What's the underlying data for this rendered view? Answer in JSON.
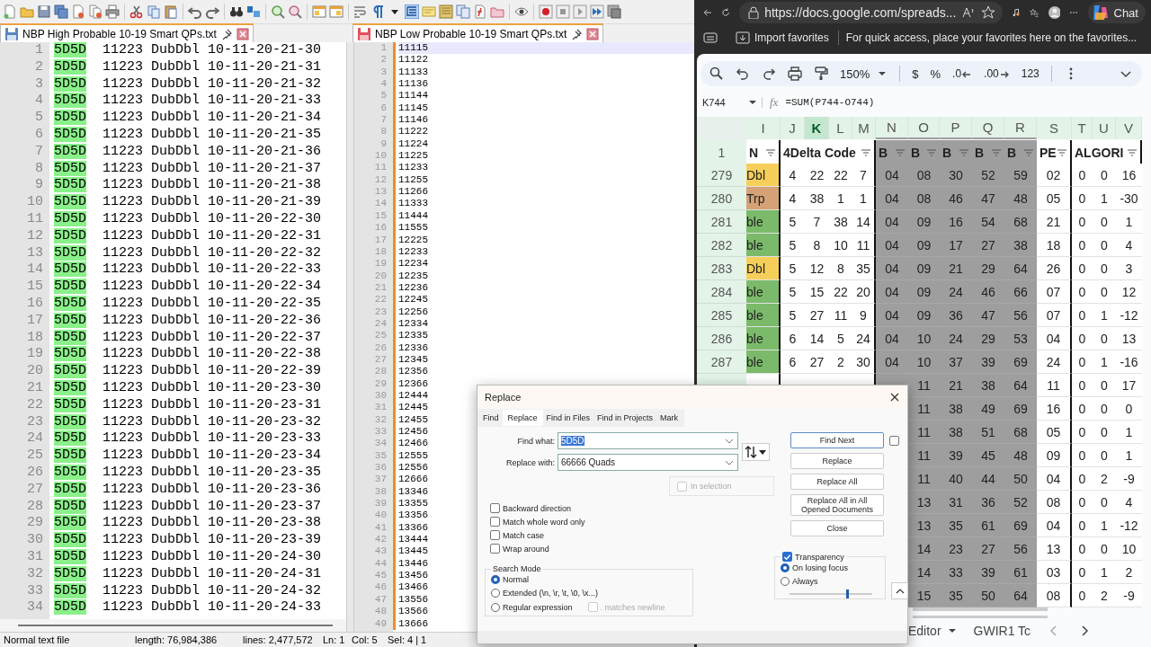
{
  "editor": {
    "tabs": [
      {
        "label": "NBP High Probable 10-19 Smart QPs.txt",
        "unsaved": false
      },
      {
        "label": "NBP Low Probable 10-19 Smart QPs.txt",
        "unsaved": true
      }
    ],
    "left_view": {
      "lines": [
        {
          "number": "1",
          "match": "5D5D",
          "text": "11223 DubDbl 10-11-20-21-30"
        },
        {
          "number": "2",
          "match": "5D5D",
          "text": "11223 DubDbl 10-11-20-21-31"
        },
        {
          "number": "3",
          "match": "5D5D",
          "text": "11223 DubDbl 10-11-20-21-32"
        },
        {
          "number": "4",
          "match": "5D5D",
          "text": "11223 DubDbl 10-11-20-21-33"
        },
        {
          "number": "5",
          "match": "5D5D",
          "text": "11223 DubDbl 10-11-20-21-34"
        },
        {
          "number": "6",
          "match": "5D5D",
          "text": "11223 DubDbl 10-11-20-21-35"
        },
        {
          "number": "7",
          "match": "5D5D",
          "text": "11223 DubDbl 10-11-20-21-36"
        },
        {
          "number": "8",
          "match": "5D5D",
          "text": "11223 DubDbl 10-11-20-21-37"
        },
        {
          "number": "9",
          "match": "5D5D",
          "text": "11223 DubDbl 10-11-20-21-38"
        },
        {
          "number": "10",
          "match": "5D5D",
          "text": "11223 DubDbl 10-11-20-21-39"
        },
        {
          "number": "11",
          "match": "5D5D",
          "text": "11223 DubDbl 10-11-20-22-30"
        },
        {
          "number": "12",
          "match": "5D5D",
          "text": "11223 DubDbl 10-11-20-22-31"
        },
        {
          "number": "13",
          "match": "5D5D",
          "text": "11223 DubDbl 10-11-20-22-32"
        },
        {
          "number": "14",
          "match": "5D5D",
          "text": "11223 DubDbl 10-11-20-22-33"
        },
        {
          "number": "15",
          "match": "5D5D",
          "text": "11223 DubDbl 10-11-20-22-34"
        },
        {
          "number": "16",
          "match": "5D5D",
          "text": "11223 DubDbl 10-11-20-22-35"
        },
        {
          "number": "17",
          "match": "5D5D",
          "text": "11223 DubDbl 10-11-20-22-36"
        },
        {
          "number": "18",
          "match": "5D5D",
          "text": "11223 DubDbl 10-11-20-22-37"
        },
        {
          "number": "19",
          "match": "5D5D",
          "text": "11223 DubDbl 10-11-20-22-38"
        },
        {
          "number": "20",
          "match": "5D5D",
          "text": "11223 DubDbl 10-11-20-22-39"
        },
        {
          "number": "21",
          "match": "5D5D",
          "text": "11223 DubDbl 10-11-20-23-30"
        },
        {
          "number": "22",
          "match": "5D5D",
          "text": "11223 DubDbl 10-11-20-23-31"
        },
        {
          "number": "23",
          "match": "5D5D",
          "text": "11223 DubDbl 10-11-20-23-32"
        },
        {
          "number": "24",
          "match": "5D5D",
          "text": "11223 DubDbl 10-11-20-23-33"
        },
        {
          "number": "25",
          "match": "5D5D",
          "text": "11223 DubDbl 10-11-20-23-34"
        },
        {
          "number": "26",
          "match": "5D5D",
          "text": "11223 DubDbl 10-11-20-23-35"
        },
        {
          "number": "27",
          "match": "5D5D",
          "text": "11223 DubDbl 10-11-20-23-36"
        },
        {
          "number": "28",
          "match": "5D5D",
          "text": "11223 DubDbl 10-11-20-23-37"
        },
        {
          "number": "29",
          "match": "5D5D",
          "text": "11223 DubDbl 10-11-20-23-38"
        },
        {
          "number": "30",
          "match": "5D5D",
          "text": "11223 DubDbl 10-11-20-23-39"
        },
        {
          "number": "31",
          "match": "5D5D",
          "text": "11223 DubDbl 10-11-20-24-30"
        },
        {
          "number": "32",
          "match": "5D5D",
          "text": "11223 DubDbl 10-11-20-24-31"
        },
        {
          "number": "33",
          "match": "5D5D",
          "text": "11223 DubDbl 10-11-20-24-32"
        },
        {
          "number": "34",
          "match": "5D5D",
          "text": "11223 DubDbl 10-11-20-24-33"
        }
      ]
    },
    "right_view": {
      "lines": [
        {
          "number": "1",
          "text": "11115",
          "current": true
        },
        {
          "number": "2",
          "text": "11122",
          "current": false
        },
        {
          "number": "3",
          "text": "11133",
          "current": false
        },
        {
          "number": "4",
          "text": "11136",
          "current": false
        },
        {
          "number": "5",
          "text": "11144",
          "current": false
        },
        {
          "number": "6",
          "text": "11145",
          "current": false
        },
        {
          "number": "7",
          "text": "11146",
          "current": false
        },
        {
          "number": "8",
          "text": "11222",
          "current": false
        },
        {
          "number": "9",
          "text": "11224",
          "current": false
        },
        {
          "number": "10",
          "text": "11225",
          "current": false
        },
        {
          "number": "11",
          "text": "11233",
          "current": false
        },
        {
          "number": "12",
          "text": "11255",
          "current": false
        },
        {
          "number": "13",
          "text": "11266",
          "current": false
        },
        {
          "number": "14",
          "text": "11333",
          "current": false
        },
        {
          "number": "15",
          "text": "11444",
          "current": false
        },
        {
          "number": "16",
          "text": "11555",
          "current": false
        },
        {
          "number": "17",
          "text": "12225",
          "current": false
        },
        {
          "number": "18",
          "text": "12233",
          "current": false
        },
        {
          "number": "19",
          "text": "12234",
          "current": false
        },
        {
          "number": "20",
          "text": "12235",
          "current": false
        },
        {
          "number": "21",
          "text": "12236",
          "current": false
        },
        {
          "number": "22",
          "text": "12245",
          "current": false
        },
        {
          "number": "23",
          "text": "12256",
          "current": false
        },
        {
          "number": "24",
          "text": "12334",
          "current": false
        },
        {
          "number": "25",
          "text": "12335",
          "current": false
        },
        {
          "number": "26",
          "text": "12336",
          "current": false
        },
        {
          "number": "27",
          "text": "12345",
          "current": false
        },
        {
          "number": "28",
          "text": "12356",
          "current": false
        },
        {
          "number": "29",
          "text": "12366",
          "current": false
        },
        {
          "number": "30",
          "text": "12444",
          "current": false
        },
        {
          "number": "31",
          "text": "12445",
          "current": false
        },
        {
          "number": "32",
          "text": "12455",
          "current": false
        },
        {
          "number": "33",
          "text": "12456",
          "current": false
        },
        {
          "number": "34",
          "text": "12466",
          "current": false
        },
        {
          "number": "35",
          "text": "12555",
          "current": false
        },
        {
          "number": "36",
          "text": "12556",
          "current": false
        },
        {
          "number": "37",
          "text": "12666",
          "current": false
        },
        {
          "number": "38",
          "text": "13346",
          "current": false
        },
        {
          "number": "39",
          "text": "13355",
          "current": false
        },
        {
          "number": "40",
          "text": "13356",
          "current": false
        },
        {
          "number": "41",
          "text": "13366",
          "current": false
        },
        {
          "number": "42",
          "text": "13444",
          "current": false
        },
        {
          "number": "43",
          "text": "13445",
          "current": false
        },
        {
          "number": "44",
          "text": "13446",
          "current": false
        },
        {
          "number": "45",
          "text": "13456",
          "current": false
        },
        {
          "number": "46",
          "text": "13466",
          "current": false
        },
        {
          "number": "47",
          "text": "13556",
          "current": false
        },
        {
          "number": "48",
          "text": "13566",
          "current": false
        },
        {
          "number": "49",
          "text": "13666",
          "current": false
        }
      ]
    },
    "status_bar": {
      "file_type": "Normal text file",
      "length": "length: 76,984,386",
      "lines": "lines: 2,477,572",
      "ln": "Ln: 1",
      "col": "Col: 5",
      "sel": "Sel: 4 | 1"
    }
  },
  "browser": {
    "url": "https://docs.google.com/spreads...",
    "chat": "Chat",
    "favorites_bar": {
      "import": "Import favorites",
      "hint": "For quick access, place your favorites here on the favorites..."
    },
    "sheets": {
      "toolbar": {
        "zoom": "150%",
        "currency": "$",
        "percent": "%",
        "decrease_decimal": ".0",
        "increase_decimal": ".00",
        "number_format": "123"
      },
      "name_box": "K744",
      "fx": "fx",
      "formula": "=SUM(P744-O744)",
      "columns": [
        {
          "label": "I",
          "selected": false,
          "shaded": false
        },
        {
          "label": "J",
          "selected": false,
          "shaded": false
        },
        {
          "label": "K",
          "selected": true,
          "shaded": false
        },
        {
          "label": "L",
          "selected": false,
          "shaded": false
        },
        {
          "label": "M",
          "selected": false,
          "shaded": false
        },
        {
          "label": "N",
          "selected": false,
          "shaded": true
        },
        {
          "label": "O",
          "selected": false,
          "shaded": true
        },
        {
          "label": "P",
          "selected": false,
          "shaded": true
        },
        {
          "label": "Q",
          "selected": false,
          "shaded": true
        },
        {
          "label": "R",
          "selected": false,
          "shaded": true
        },
        {
          "label": "S",
          "selected": false,
          "shaded": false
        },
        {
          "label": "T",
          "selected": false,
          "shaded": false
        },
        {
          "label": "U",
          "selected": false,
          "shaded": false
        },
        {
          "label": "V",
          "selected": false,
          "shaded": false
        }
      ],
      "header_row": {
        "number": "1",
        "cells": [
          "N",
          "4Delta Code",
          "B",
          "B",
          "B",
          "B",
          "B",
          "PE",
          "ALGORI"
        ]
      },
      "rows": [
        {
          "number": "279",
          "color": "#f6cf5a",
          "cells": [
            "Dbl",
            "4",
            "22",
            "22",
            "7",
            "04",
            "08",
            "30",
            "52",
            "59",
            "02",
            "0",
            "0",
            "16"
          ]
        },
        {
          "number": "280",
          "color": "#d4a276",
          "cells": [
            "Trp",
            "4",
            "38",
            "1",
            "1",
            "04",
            "08",
            "46",
            "47",
            "48",
            "05",
            "0",
            "1",
            "-30"
          ]
        },
        {
          "number": "281",
          "color": "#7bba6a",
          "cells": [
            "ble",
            "5",
            "7",
            "38",
            "14",
            "04",
            "09",
            "16",
            "54",
            "68",
            "21",
            "0",
            "0",
            "1"
          ]
        },
        {
          "number": "282",
          "color": "#7bba6a",
          "cells": [
            "ble",
            "5",
            "8",
            "10",
            "11",
            "04",
            "09",
            "17",
            "27",
            "38",
            "18",
            "0",
            "0",
            "4"
          ]
        },
        {
          "number": "283",
          "color": "#f6cf5a",
          "cells": [
            "Dbl",
            "5",
            "12",
            "8",
            "35",
            "04",
            "09",
            "21",
            "29",
            "64",
            "26",
            "0",
            "0",
            "3"
          ]
        },
        {
          "number": "284",
          "color": "#7bba6a",
          "cells": [
            "ble",
            "5",
            "15",
            "22",
            "20",
            "04",
            "09",
            "24",
            "46",
            "66",
            "07",
            "0",
            "0",
            "12"
          ]
        },
        {
          "number": "285",
          "color": "#7bba6a",
          "cells": [
            "ble",
            "5",
            "27",
            "11",
            "9",
            "04",
            "09",
            "36",
            "47",
            "56",
            "07",
            "0",
            "1",
            "-12"
          ]
        },
        {
          "number": "286",
          "color": "#7bba6a",
          "cells": [
            "ble",
            "6",
            "14",
            "5",
            "24",
            "04",
            "10",
            "24",
            "29",
            "53",
            "04",
            "0",
            "0",
            "13"
          ]
        },
        {
          "number": "287",
          "color": "#7bba6a",
          "cells": [
            "ble",
            "6",
            "27",
            "2",
            "30",
            "04",
            "10",
            "37",
            "39",
            "69",
            "24",
            "0",
            "1",
            "-16"
          ]
        },
        {
          "cells": [
            "",
            "",
            "",
            "",
            "",
            "",
            "11",
            "21",
            "38",
            "64",
            "11",
            "0",
            "0",
            "17"
          ]
        },
        {
          "cells": [
            "",
            "",
            "",
            "",
            "",
            "",
            "11",
            "38",
            "49",
            "69",
            "16",
            "0",
            "0",
            "0"
          ]
        },
        {
          "cells": [
            "",
            "",
            "",
            "",
            "",
            "",
            "11",
            "38",
            "51",
            "68",
            "05",
            "0",
            "0",
            "1"
          ]
        },
        {
          "cells": [
            "",
            "",
            "",
            "",
            "",
            "",
            "11",
            "39",
            "45",
            "48",
            "09",
            "0",
            "0",
            "1"
          ]
        },
        {
          "cells": [
            "",
            "",
            "",
            "",
            "",
            "",
            "11",
            "40",
            "44",
            "50",
            "04",
            "0",
            "2",
            "-9"
          ]
        },
        {
          "cells": [
            "",
            "",
            "",
            "",
            "",
            "",
            "13",
            "31",
            "36",
            "52",
            "08",
            "0",
            "0",
            "4"
          ]
        },
        {
          "cells": [
            "",
            "",
            "",
            "",
            "",
            "",
            "13",
            "35",
            "61",
            "69",
            "04",
            "0",
            "1",
            "-12"
          ]
        },
        {
          "cells": [
            "",
            "",
            "",
            "",
            "",
            "",
            "14",
            "23",
            "27",
            "56",
            "13",
            "0",
            "0",
            "10"
          ]
        },
        {
          "cells": [
            "",
            "",
            "",
            "",
            "",
            "",
            "14",
            "33",
            "39",
            "61",
            "03",
            "0",
            "1",
            "2"
          ]
        },
        {
          "cells": [
            "",
            "",
            "",
            "",
            "",
            "",
            "15",
            "35",
            "50",
            "64",
            "08",
            "0",
            "2",
            "-9"
          ]
        }
      ],
      "sheet_tabs": [
        {
          "label": "Editor"
        },
        {
          "label": "GWIR1 Tc"
        }
      ]
    }
  },
  "dialog": {
    "title": "Replace",
    "tabs": [
      {
        "label": "Find",
        "selected": false
      },
      {
        "label": "Replace",
        "selected": true
      },
      {
        "label": "Find in Files",
        "selected": false
      },
      {
        "label": "Find in Projects",
        "selected": false
      },
      {
        "label": "Mark",
        "selected": false
      }
    ],
    "find_what": {
      "label": "Find what:",
      "value": "5D5D",
      "selected": true
    },
    "replace_with": {
      "label": "Replace with:",
      "value": "66666 Quads",
      "selected": false
    },
    "in_selection": {
      "label": "In selection",
      "checked": false,
      "disabled": true
    },
    "buttons": [
      "Find Next",
      "Replace",
      "Replace All",
      "Replace All in All Opened Documents",
      "Close"
    ],
    "find_next_option": {
      "checked": false
    },
    "options": [
      {
        "label": "Backward direction",
        "checked": false
      },
      {
        "label": "Match whole word only",
        "checked": false
      },
      {
        "label": "Match case",
        "checked": false
      },
      {
        "label": "Wrap around",
        "checked": false
      }
    ],
    "search_mode": {
      "title": "Search Mode",
      "modes": [
        {
          "label": "Normal",
          "selected": true
        },
        {
          "label": "Extended (\\n, \\r, \\t, \\0, \\x...)",
          "selected": false
        },
        {
          "label": "Regular expression",
          "selected": false
        }
      ],
      "matches_newline": {
        "label": ". matches newline",
        "checked": false,
        "disabled": true
      }
    },
    "transparency": {
      "label": "Transparency",
      "checked": true,
      "modes": [
        {
          "label": "On losing focus",
          "selected": true
        },
        {
          "label": "Always",
          "selected": false
        }
      ],
      "level": 0.7
    }
  }
}
